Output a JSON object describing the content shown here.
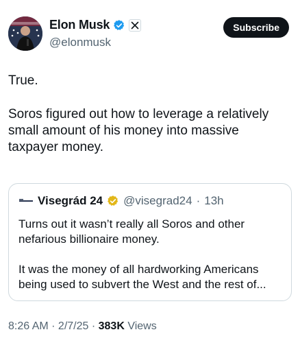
{
  "author": {
    "name": "Elon Musk",
    "handle": "@elonmusk",
    "subscribe_label": "Subscribe"
  },
  "post": {
    "paragraphs": [
      "True.",
      "Soros figured out how to leverage a relatively small amount of his money into massive taxpayer money."
    ]
  },
  "quoted": {
    "name": "Visegrád 24",
    "handle": "@visegrad24",
    "separator": "·",
    "age": "13h",
    "paragraphs": [
      "Turns out it wasn’t really all Soros and other nefarious billionaire money.",
      "It was the money of all hardworking Americans being used to subvert the West and the rest of..."
    ]
  },
  "meta": {
    "time": "8:26 AM",
    "sep1": " · ",
    "date": "2/7/25",
    "sep2": " · ",
    "views_count": "383K",
    "views_label": " Views"
  },
  "colors": {
    "verified_blue": "#1d9bf0",
    "gold_badge": "#e2b719",
    "text_primary": "#0f1419",
    "text_secondary": "#536471",
    "border": "#cfd9de"
  },
  "icons": {
    "verified": "verified-badge-icon",
    "affiliation": "x-logo-icon",
    "gold": "gold-verified-badge-icon"
  }
}
